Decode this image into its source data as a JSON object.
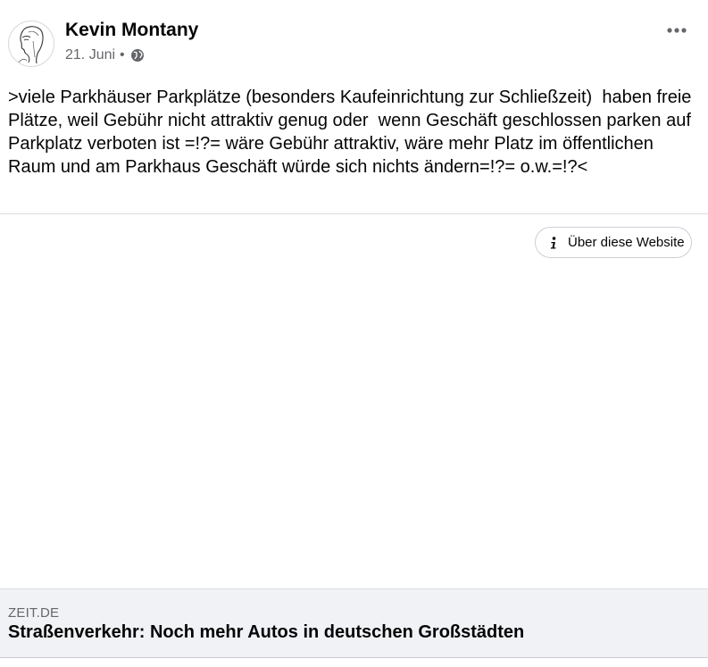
{
  "post": {
    "author": "Kevin Montany",
    "date": "21. Juni",
    "separator": "•",
    "privacy_icon": "globe-icon",
    "more_icon": "more-horizontal-icon",
    "text": ">viele Parkhäuser Parkplätze (besonders Kaufeinrichtung zur Schließzeit)  haben freie Plätze, weil Gebühr nicht attraktiv genug oder  wenn Geschäft geschlossen parken auf Parkplatz verboten ist =!?= wäre Gebühr attraktiv, wäre mehr Platz im öffentlichen Raum und am Parkhaus Geschäft würde sich nichts ändern=!?= o.w.=!?<"
  },
  "link_preview": {
    "about_button_label": "Über diese Website",
    "about_icon": "info-icon",
    "domain": "ZEIT.DE",
    "title": "Straßenverkehr: Noch mehr Autos in deutschen Großstädten"
  },
  "colors": {
    "text": "#050505",
    "secondary_text": "#65676b",
    "divider": "#dadde1",
    "card_background": "#f0f2f5"
  }
}
